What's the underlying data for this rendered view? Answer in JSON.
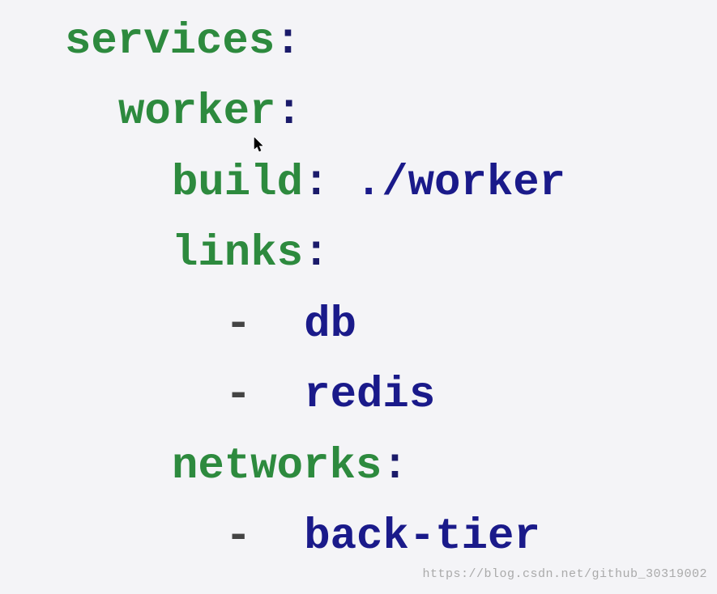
{
  "code": {
    "line1_key": "services",
    "line2_key": "worker",
    "line3_key": "build",
    "line3_value": "./worker",
    "line4_key": "links",
    "line5_value": "db",
    "line6_value": "redis",
    "line7_key": "networks",
    "line8_value": "back-tier",
    "colon": ":",
    "dash": "-",
    "space": " "
  },
  "watermark": "https://blog.csdn.net/github_30319002",
  "cursor_glyph": "➤"
}
